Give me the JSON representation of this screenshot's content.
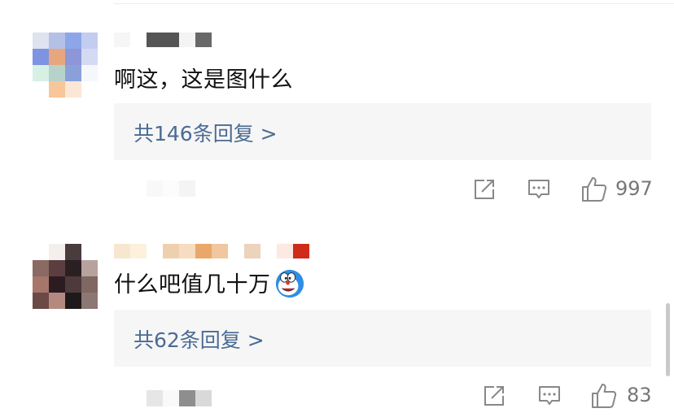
{
  "comments": [
    {
      "text": "啊这，这是图什么",
      "reply_link": "共146条回复 >",
      "like_count": "997"
    },
    {
      "text": "什么吧值几十万",
      "reply_link": "共62条回复 >",
      "like_count": "83"
    }
  ],
  "icons": {
    "share": "share-icon",
    "comment": "comment-icon",
    "like": "thumbs-up-icon",
    "emoji": "doraemon-emoji-icon"
  },
  "colors": {
    "reply_link": "#4b6b94",
    "reply_box_bg": "#f6f6f6",
    "action_icon": "#888888"
  }
}
